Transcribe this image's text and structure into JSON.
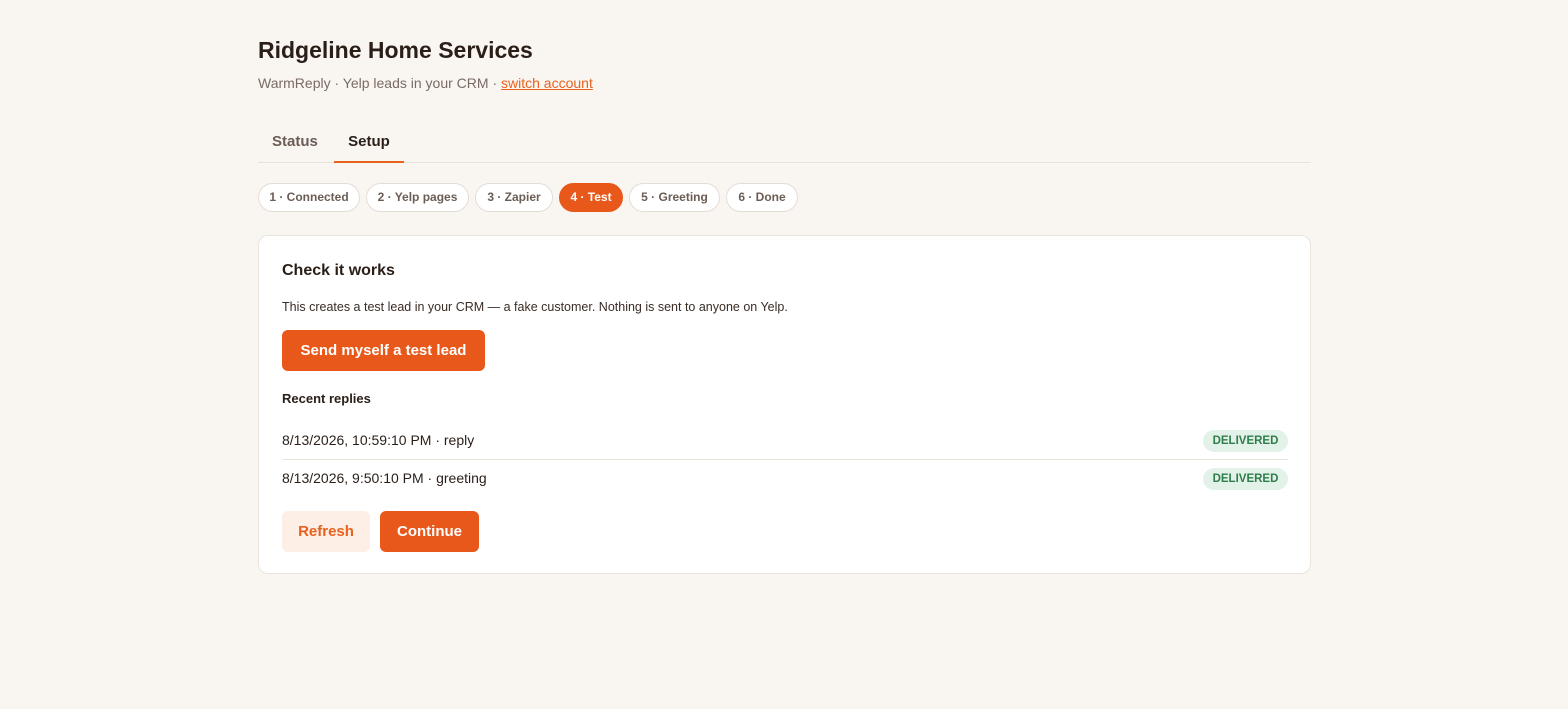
{
  "header": {
    "title": "Ridgeline Home Services",
    "subtitle": "WarmReply · Yelp leads in your CRM · ",
    "switch_account": "switch account"
  },
  "tabs": [
    {
      "label": "Status",
      "active": false
    },
    {
      "label": "Setup",
      "active": true
    }
  ],
  "steps": [
    {
      "label": "1 · Connected",
      "active": false
    },
    {
      "label": "2 · Yelp pages",
      "active": false
    },
    {
      "label": "3 · Zapier",
      "active": false
    },
    {
      "label": "4 · Test",
      "active": true
    },
    {
      "label": "5 · Greeting",
      "active": false
    },
    {
      "label": "6 · Done",
      "active": false
    }
  ],
  "card": {
    "title": "Check it works",
    "description": "This creates a test lead in your CRM — a fake customer. Nothing is sent to anyone on Yelp.",
    "test_button": "Send myself a test lead",
    "recent_label": "Recent replies",
    "replies": [
      {
        "text": "8/13/2026, 10:59:10 PM · reply",
        "status": "DELIVERED"
      },
      {
        "text": "8/13/2026, 9:50:10 PM · greeting",
        "status": "DELIVERED"
      }
    ],
    "refresh_button": "Refresh",
    "continue_button": "Continue"
  },
  "colors": {
    "accent": "#e8581a",
    "background": "#f9f6f2",
    "delivered": "#2e7d4a"
  }
}
